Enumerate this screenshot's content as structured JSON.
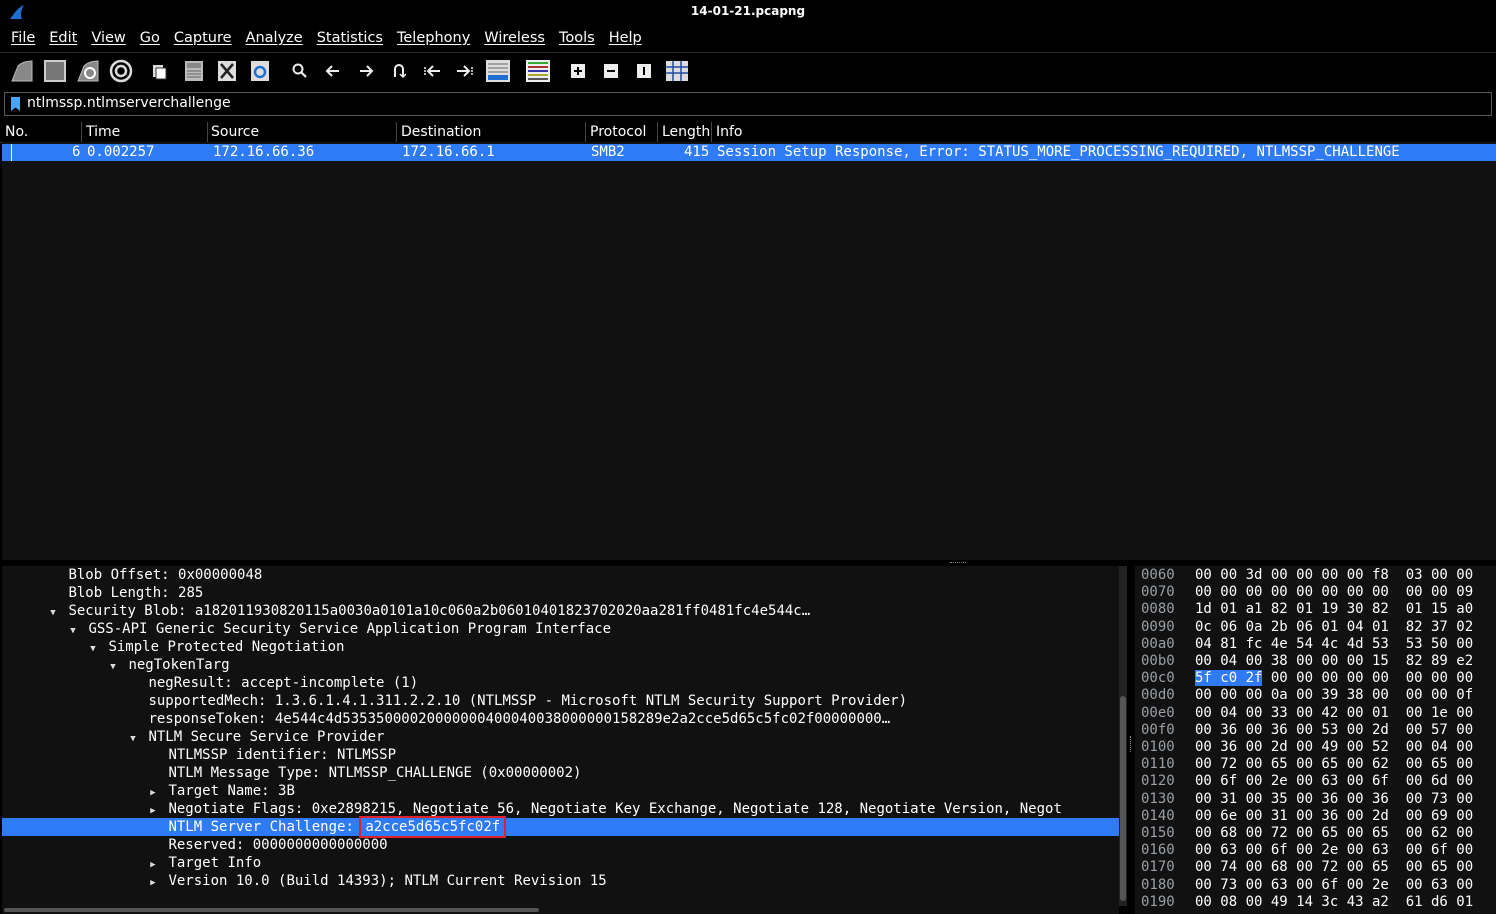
{
  "window": {
    "title": "14-01-21.pcapng"
  },
  "menu": [
    "File",
    "Edit",
    "View",
    "Go",
    "Capture",
    "Analyze",
    "Statistics",
    "Telephony",
    "Wireless",
    "Tools",
    "Help"
  ],
  "toolbar_icons": [
    "shark-fin-start-icon",
    "stop-square-icon",
    "restart-fin-icon",
    "capture-options-gear-icon",
    "open-file-icon",
    "save-file-icon",
    "close-file-icon",
    "reload-file-icon",
    "find-packet-icon",
    "go-back-icon",
    "go-forward-icon",
    "go-to-packet-icon",
    "first-packet-icon",
    "last-packet-icon",
    "auto-scroll-icon",
    "colorize-icon",
    "zoom-in-icon",
    "zoom-out-icon",
    "normal-size-icon",
    "resize-columns-icon"
  ],
  "filter": {
    "value": "ntlmssp.ntlmserverchallenge"
  },
  "packet_list": {
    "columns": [
      "No.",
      "Time",
      "Source",
      "Destination",
      "Protocol",
      "Length",
      "Info"
    ],
    "rows": [
      {
        "no": "6",
        "time": "0.002257",
        "source": "172.16.66.36",
        "destination": "172.16.66.1",
        "protocol": "SMB2",
        "length": "415",
        "info": "Session Setup Response, Error: STATUS_MORE_PROCESSING_REQUIRED, NTLMSSP_CHALLENGE"
      }
    ]
  },
  "details": [
    {
      "indent": 0,
      "arrow": "",
      "text": "Blob Offset: 0x00000048"
    },
    {
      "indent": 0,
      "arrow": "",
      "text": "Blob Length: 285"
    },
    {
      "indent": 0,
      "arrow": "open",
      "text": "Security Blob: a182011930820115a0030a0101a10c060a2b06010401823702020aa281ff0481fc4e544c…"
    },
    {
      "indent": 1,
      "arrow": "open",
      "text": "GSS-API Generic Security Service Application Program Interface"
    },
    {
      "indent": 2,
      "arrow": "open",
      "text": "Simple Protected Negotiation"
    },
    {
      "indent": 3,
      "arrow": "open",
      "text": "negTokenTarg"
    },
    {
      "indent": 4,
      "arrow": "",
      "text": "negResult: accept-incomplete (1)"
    },
    {
      "indent": 4,
      "arrow": "",
      "text": "supportedMech: 1.3.6.1.4.1.311.2.2.10 (NTLMSSP - Microsoft NTLM Security Support Provider)"
    },
    {
      "indent": 4,
      "arrow": "",
      "text": "responseToken: 4e544c4d53535000020000000400040038000000158289e2a2cce5d65c5fc02f00000000…"
    },
    {
      "indent": 4,
      "arrow": "open",
      "text": "NTLM Secure Service Provider"
    },
    {
      "indent": 5,
      "arrow": "",
      "text": "NTLMSSP identifier: NTLMSSP"
    },
    {
      "indent": 5,
      "arrow": "",
      "text": "NTLM Message Type: NTLMSSP_CHALLENGE (0x00000002)"
    },
    {
      "indent": 5,
      "arrow": "closed",
      "text": "Target Name: 3B"
    },
    {
      "indent": 5,
      "arrow": "closed",
      "text": "Negotiate Flags: 0xe2898215, Negotiate 56, Negotiate Key Exchange, Negotiate 128, Negotiate Version, Negot"
    },
    {
      "indent": 5,
      "arrow": "",
      "text": "NTLM Server Challenge: ",
      "value": "a2cce5d65c5fc02f",
      "selected": true
    },
    {
      "indent": 5,
      "arrow": "",
      "text": "Reserved: 0000000000000000"
    },
    {
      "indent": 5,
      "arrow": "closed",
      "text": "Target Info"
    },
    {
      "indent": 5,
      "arrow": "closed",
      "text": "Version 10.0 (Build 14393); NTLM Current Revision 15"
    }
  ],
  "bytes": [
    {
      "offset": "0060",
      "hex": "00 00 3d 00 00 00 00 f8  03 00 00"
    },
    {
      "offset": "0070",
      "hex": "00 00 00 00 00 00 00 00  00 00 09"
    },
    {
      "offset": "0080",
      "hex": "1d 01 a1 82 01 19 30 82  01 15 a0"
    },
    {
      "offset": "0090",
      "hex": "0c 06 0a 2b 06 01 04 01  82 37 02"
    },
    {
      "offset": "00a0",
      "hex": "04 81 fc 4e 54 4c 4d 53  53 50 00"
    },
    {
      "offset": "00b0",
      "hex": "00 04 00 38 00 00 00 15  82 89 e2"
    },
    {
      "offset": "00c0",
      "hex_sel": "5f c0 2f",
      "hex": " 00 00 00 00 00  00 00 00"
    },
    {
      "offset": "00d0",
      "hex": "00 00 00 0a 00 39 38 00  00 00 0f"
    },
    {
      "offset": "00e0",
      "hex": "00 04 00 33 00 42 00 01  00 1e 00"
    },
    {
      "offset": "00f0",
      "hex": "00 36 00 36 00 53 00 2d  00 57 00"
    },
    {
      "offset": "0100",
      "hex": "00 36 00 2d 00 49 00 52  00 04 00"
    },
    {
      "offset": "0110",
      "hex": "00 72 00 65 00 65 00 62  00 65 00"
    },
    {
      "offset": "0120",
      "hex": "00 6f 00 2e 00 63 00 6f  00 6d 00"
    },
    {
      "offset": "0130",
      "hex": "00 31 00 35 00 36 00 36  00 73 00"
    },
    {
      "offset": "0140",
      "hex": "00 6e 00 31 00 36 00 2d  00 69 00"
    },
    {
      "offset": "0150",
      "hex": "00 68 00 72 00 65 00 65  00 62 00"
    },
    {
      "offset": "0160",
      "hex": "00 63 00 6f 00 2e 00 63  00 6f 00"
    },
    {
      "offset": "0170",
      "hex": "00 74 00 68 00 72 00 65  00 65 00"
    },
    {
      "offset": "0180",
      "hex": "00 73 00 63 00 6f 00 2e  00 63 00"
    },
    {
      "offset": "0190",
      "hex": "00 08 00 49 14 3c 43 a2  61 d6 01"
    }
  ],
  "colors": {
    "selection": "#2f7bf5",
    "highlight_box": "#e0202a",
    "background": "#000000",
    "pane": "#111111"
  }
}
